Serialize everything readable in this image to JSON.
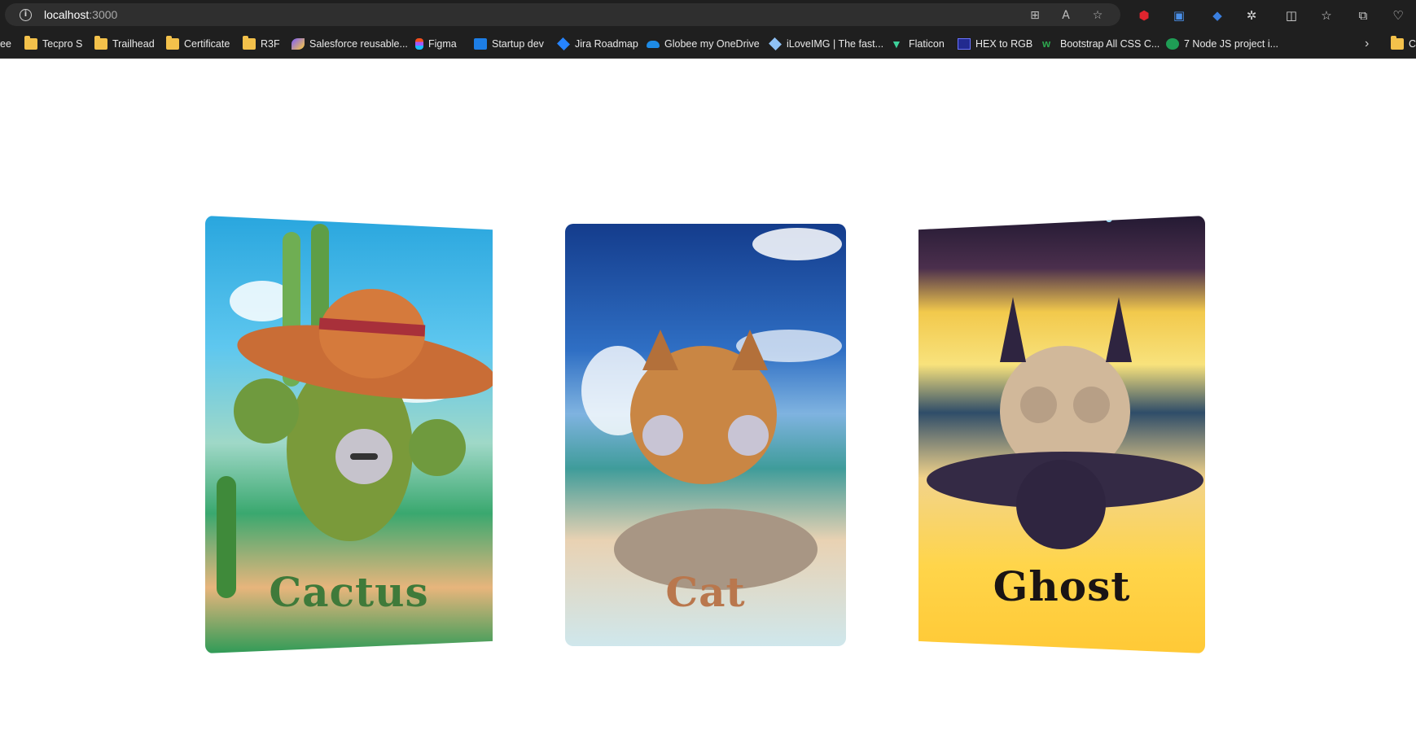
{
  "browser": {
    "url_host": "localhost",
    "url_port": ":3000"
  },
  "bookmarks": [
    {
      "label": "ee",
      "icon": "partial-icon"
    },
    {
      "label": "Tecpro S",
      "icon": "folder-icon"
    },
    {
      "label": "Trailhead",
      "icon": "folder-icon"
    },
    {
      "label": "Certificate",
      "icon": "folder-icon"
    },
    {
      "label": "R3F",
      "icon": "folder-icon"
    },
    {
      "label": "Salesforce reusable...",
      "icon": "salesforce-icon"
    },
    {
      "label": "Figma",
      "icon": "figma-icon"
    },
    {
      "label": "Startup dev",
      "icon": "trello-icon"
    },
    {
      "label": "Jira Roadmap",
      "icon": "jira-icon"
    },
    {
      "label": "Globee my OneDrive",
      "icon": "onedrive-icon"
    },
    {
      "label": "iLoveIMG | The fast...",
      "icon": "iloveimg-icon"
    },
    {
      "label": "Flaticon",
      "icon": "flaticon-icon"
    },
    {
      "label": "HEX to RGB",
      "icon": "hex-icon"
    },
    {
      "label": "Bootstrap All CSS C...",
      "icon": "bootstrap-icon"
    },
    {
      "label": "7 Node JS project i...",
      "icon": "node-icon"
    },
    {
      "label": "C",
      "icon": "folder-icon"
    }
  ],
  "cards": [
    {
      "title": "Cactus",
      "color": "#3f7a3a"
    },
    {
      "title": "Cat",
      "color": "#b9774d"
    },
    {
      "title": "Ghost",
      "color": "#1a1414"
    }
  ]
}
